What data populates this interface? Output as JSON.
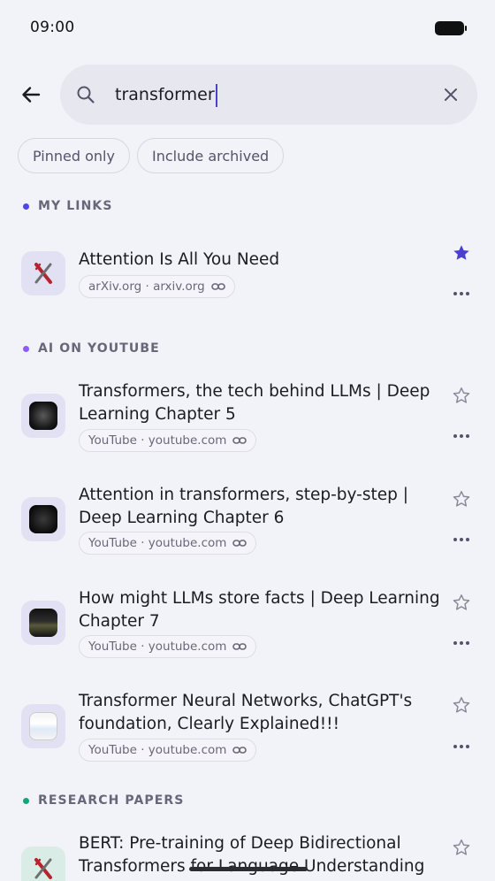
{
  "status_bar": {
    "time": "09:00"
  },
  "search": {
    "value": "transformer"
  },
  "filters": {
    "pinned_label": "Pinned only",
    "archived_label": "Include archived"
  },
  "colors": {
    "accent": "#5b4fd6",
    "ai_dot": "#8b5cf6",
    "research_dot": "#16a37a",
    "my_links_dot": "#4f46e5"
  },
  "sections": {
    "my_links": {
      "header": "MY LINKS",
      "items": [
        {
          "title": "Attention Is All You Need",
          "source": "arXiv.org · arxiv.org",
          "starred": true,
          "icon": "arxiv-logo"
        }
      ]
    },
    "ai_youtube": {
      "header": "AI ON YOUTUBE",
      "items": [
        {
          "title": "Transformers, the tech behind LLMs | Deep Learning Chapter 5",
          "source": "YouTube · youtube.com",
          "starred": false,
          "icon": "video-thumbnail"
        },
        {
          "title": "Attention in transformers, step-by-step | Deep Learning Chapter 6",
          "source": "YouTube · youtube.com",
          "starred": false,
          "icon": "video-thumbnail"
        },
        {
          "title": "How might LLMs store facts | Deep Learning Chapter 7",
          "source": "YouTube · youtube.com",
          "starred": false,
          "icon": "video-thumbnail"
        },
        {
          "title": "Transformer Neural Networks, ChatGPT's foundation, Clearly Explained!!!",
          "source": "YouTube · youtube.com",
          "starred": false,
          "icon": "video-thumbnail"
        }
      ]
    },
    "research": {
      "header": "RESEARCH PAPERS",
      "items": [
        {
          "title": "BERT: Pre-training of Deep Bidirectional Transformers for Language Understanding",
          "starred": false,
          "icon": "arxiv-logo"
        }
      ]
    }
  }
}
